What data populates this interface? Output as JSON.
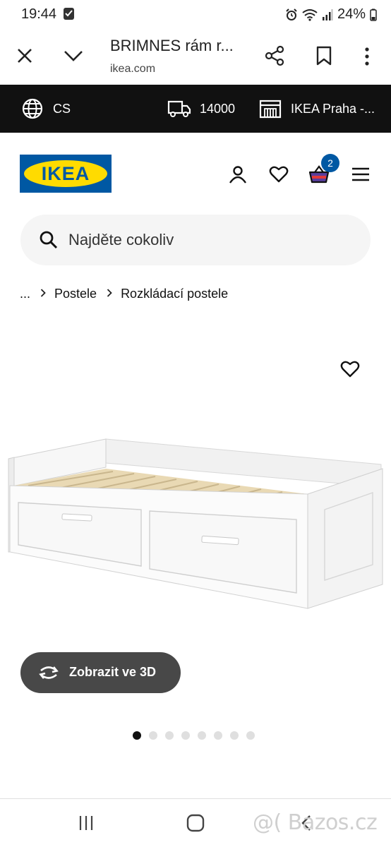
{
  "status_bar": {
    "time": "19:44",
    "battery": "24%"
  },
  "browser": {
    "title": "BRIMNES rám r...",
    "url": "ikea.com"
  },
  "location_bar": {
    "language": "CS",
    "postal_code": "14000",
    "store": "IKEA Praha -..."
  },
  "header": {
    "logo_text": "IKEA",
    "cart_count": "2"
  },
  "search": {
    "placeholder": "Najděte cokoliv"
  },
  "breadcrumb": {
    "ellipsis": "...",
    "items": [
      "Postele",
      "Rozkládací postele"
    ]
  },
  "product": {
    "view_3d_label": "Zobrazit ve 3D",
    "gallery_total": 8,
    "gallery_active": 1
  },
  "watermark": "@( Bazos.cz",
  "colors": {
    "ikea_blue": "#0058a3",
    "ikea_yellow": "#ffdb00",
    "location_bar_bg": "#111111",
    "button_3d_bg": "#484848"
  }
}
